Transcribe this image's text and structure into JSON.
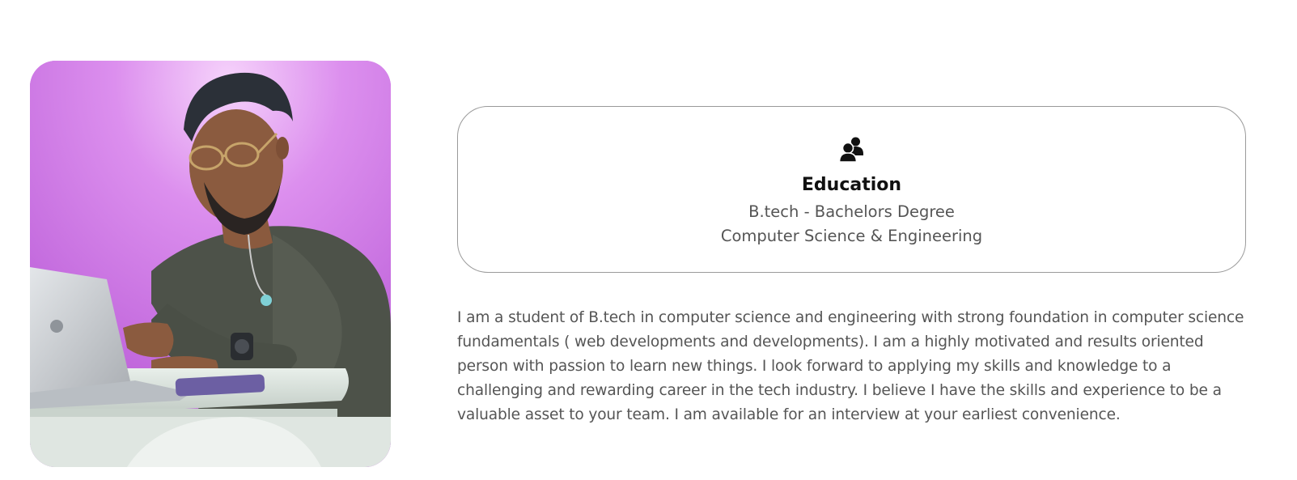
{
  "profile": {
    "photo_alt": "",
    "background_color": "#c86de0"
  },
  "education": {
    "icon": "user-group-icon",
    "title": "Education",
    "degree": "B.tech - Bachelors Degree",
    "field": "Computer Science & Engineering"
  },
  "about": {
    "text": "I am a student of B.tech in computer science and engineering with strong foundation in computer science fundamentals ( web developments and developments). I am a highly motivated and results oriented person with passion to learn new things. I look forward to applying my skills and knowledge to a challenging and rewarding career in the tech industry. I believe I have the skills and experience to be a valuable asset to your team. I am available for an interview at your earliest convenience."
  },
  "colors": {
    "text_body": "#555555",
    "text_heading": "#111111",
    "card_border": "#9a9a9a"
  }
}
